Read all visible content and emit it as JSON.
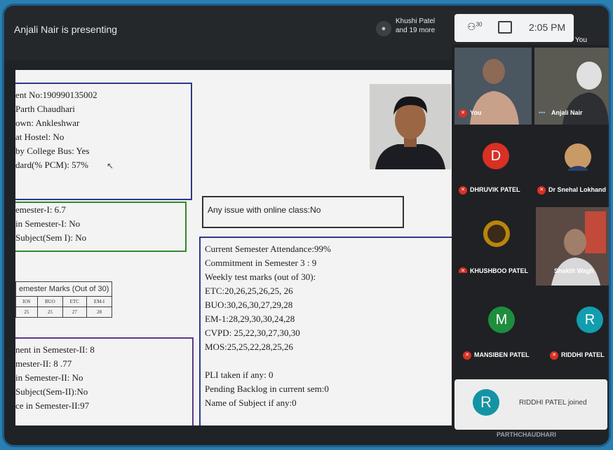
{
  "meet": {
    "presenting": "Anjali Nair is presenting",
    "roster_line1": "Khushi Patel",
    "roster_line2": "and 19 more",
    "people_count": "30",
    "time": "2:05 PM",
    "you_label": "You"
  },
  "screen": {
    "student_lines": [
      "ent No:190990135002",
      "Parth Chaudhari",
      "own: Ankleshwar",
      "at Hostel: No",
      "by College Bus: Yes",
      "dard(% PCM): 57%"
    ],
    "sem1_lines": [
      "emester-I: 6.7",
      "in Semester-I: No",
      "Subject(Sem I): No"
    ],
    "online_issue": "Any issue with online class:No",
    "marks_table": {
      "header": "emester Marks (Out of 30)",
      "columns": [
        "IOS",
        "BUO",
        "ETC",
        "EM-I"
      ],
      "values": [
        "25",
        "25",
        "27",
        "28"
      ]
    },
    "current_lines": [
      "Current Semester Attendance:99%",
      "Commitment in Semester 3 : 9",
      "Weekly test marks (out of 30):",
      "ETC:20,26,25,26,25, 26",
      "BUO:30,26,30,27,29,28",
      "EM-1:28,29,30,30,24,28",
      "CVPD: 25,22,30,27,30,30",
      "MOS:25,25,22,28,25,26",
      "",
      "PLI taken if any: 0",
      "Pending Backlog in current sem:0",
      "Name of Subject if any:0"
    ],
    "sem2_lines": [
      "nent in Semester-II: 8",
      "mester-II: 8 .77",
      "in Semester-II: No",
      "Subject(Sem-II):No",
      "ce in Semester-II:97"
    ]
  },
  "participants": {
    "you": "You",
    "anjali": "Anjali Nair",
    "dhruvik": "DHRUVIK PATEL",
    "dhruvik_initial": "D",
    "snehal": "Dr Snehal Lokhand",
    "khushboo": "KHUSHBOO PATEL",
    "shaktit": "Shaktit Wagh",
    "mansiben": "MANSIBEN PATEL",
    "mansiben_initial": "M",
    "riddhi": "RIDDHI PATEL",
    "riddhi_initial": "R"
  },
  "toast": {
    "initial": "R",
    "message": "RIDDHI PATEL joined"
  },
  "bottom_name": "PARTHCHAUDHARI",
  "colors": {
    "dhruvik": "#d93025",
    "mansiben": "#1e8e3e",
    "riddhi": "#129eaf"
  }
}
